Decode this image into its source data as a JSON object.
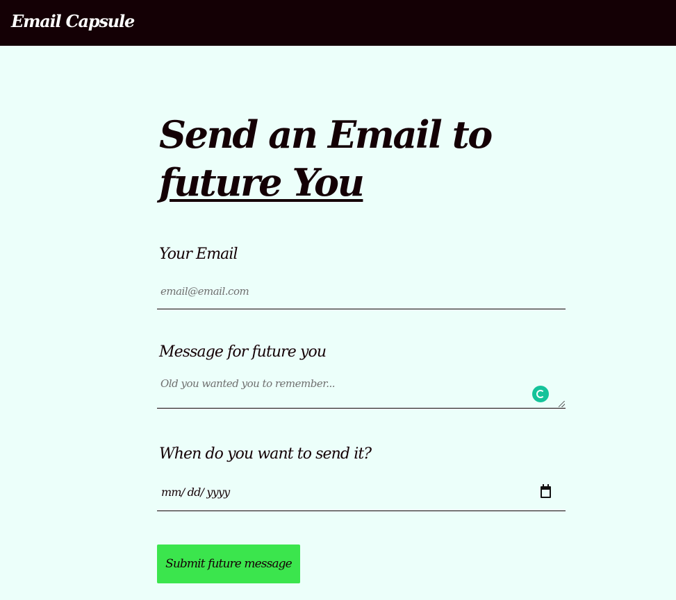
{
  "header": {
    "brand": "Email Capsule"
  },
  "hero": {
    "line1": "Send an Email to",
    "line2_prefix": "",
    "line2_accent": "future You"
  },
  "form": {
    "email": {
      "label": "Your Email",
      "placeholder": "email@email.com",
      "value": ""
    },
    "message": {
      "label": "Message for future you",
      "placeholder": "Old you wanted you to remember...",
      "value": ""
    },
    "date": {
      "label": "When do you want to send it?",
      "display": "mm/ dd/ yyyy"
    },
    "submit_label": "Submit future message"
  },
  "icons": {
    "calendar": "calendar-icon",
    "grammar": "grammarly-icon"
  },
  "colors": {
    "background": "#ecfffa",
    "header": "#140005",
    "submit": "#3be54d",
    "grammar_badge": "#15c39a"
  }
}
